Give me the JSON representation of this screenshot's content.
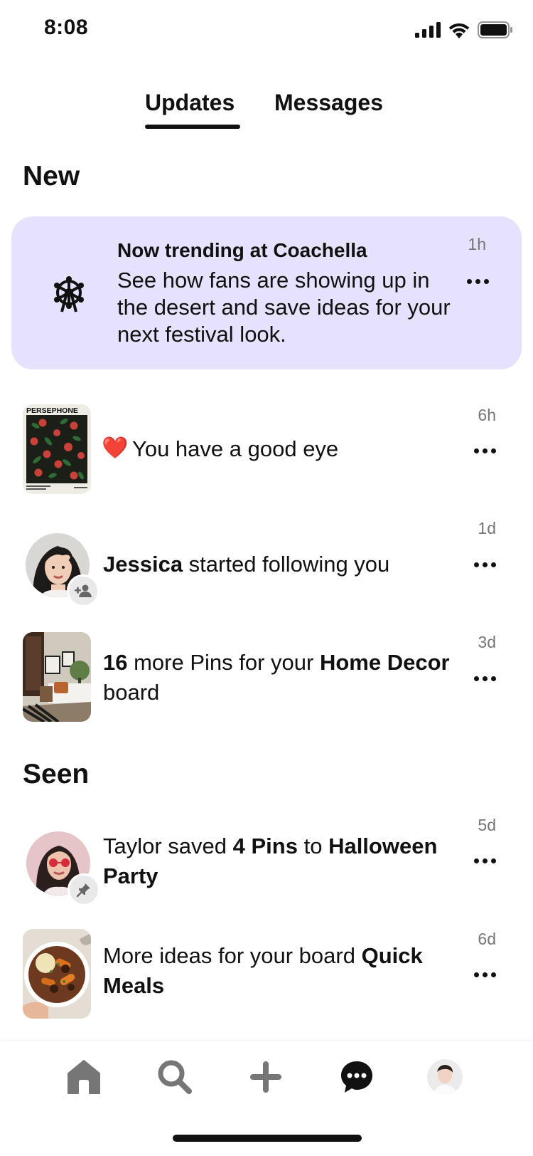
{
  "status_bar": {
    "time": "8:08"
  },
  "tabs": [
    {
      "label": "Updates",
      "active": true
    },
    {
      "label": "Messages",
      "active": false
    }
  ],
  "sections": {
    "new": "New",
    "seen": "Seen"
  },
  "trending": {
    "title": "Now trending at Coachella",
    "body": "See how fans are showing up in the desert and save ideas for your next festival look.",
    "time": "1h",
    "icon": "ferris-wheel-icon",
    "bg_color": "#e6e2fd"
  },
  "notifications": [
    {
      "pre": "",
      "b1": "",
      "mid": "You have a good eye",
      "b2": "",
      "post": "",
      "time": "6h",
      "emoji": "❤️",
      "thumb_label": "PERSEPHONE"
    },
    {
      "pre": "",
      "b1": "Jessica",
      "mid": " started following you",
      "b2": "",
      "post": "",
      "time": "1d",
      "badge": "add-person-icon"
    },
    {
      "pre": "",
      "b1": "16",
      "mid": " more Pins for your ",
      "b2": "Home Decor",
      "post": " board",
      "time": "3d"
    },
    {
      "pre": "Taylor saved ",
      "b1": "4 Pins",
      "mid": " to ",
      "b2": "Halloween Party",
      "post": "",
      "time": "5d",
      "badge": "pin-icon"
    },
    {
      "pre": "More ideas for your board ",
      "b1": "Quick Meals",
      "mid": "",
      "b2": "",
      "post": "",
      "time": "6d"
    }
  ],
  "bottom_nav": [
    "home-icon",
    "search-icon",
    "plus-icon",
    "chat-bubble-icon",
    "profile-avatar"
  ],
  "colors": {
    "icon_gray": "#767676",
    "text": "#111111"
  }
}
